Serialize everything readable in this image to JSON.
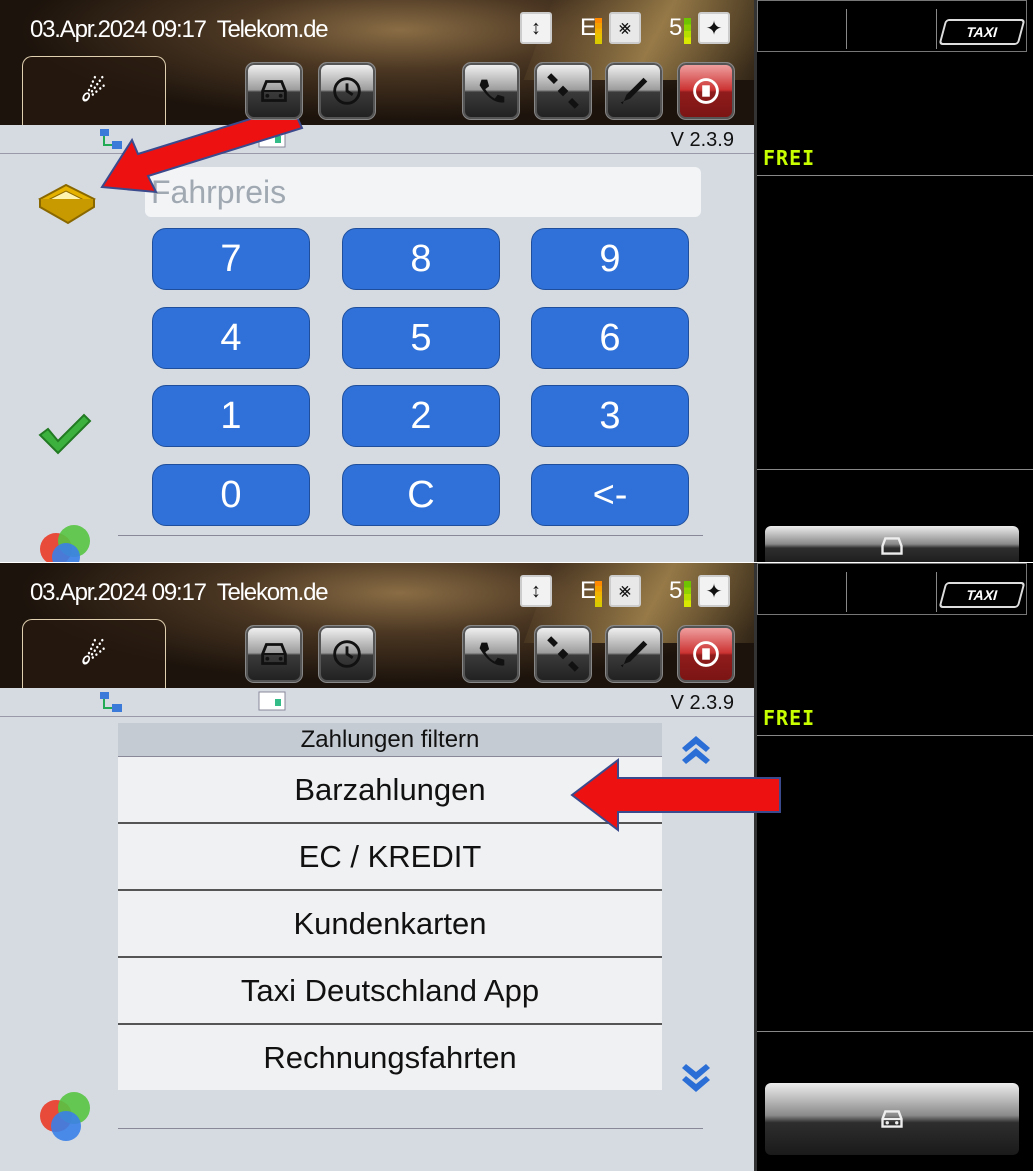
{
  "panels": [
    {
      "statusbar": {
        "datetime": "03.Apr.2024 09:17",
        "carrier": "Telekom.de",
        "signal_letter": "E",
        "satellites": "5"
      },
      "version": "V 2.3.9",
      "meter": {
        "taxi_tag": "TAXI",
        "status": "FREI"
      },
      "keypad": {
        "placeholder": "Fahrpreis",
        "keys": [
          "7",
          "8",
          "9",
          "4",
          "5",
          "6",
          "1",
          "2",
          "3",
          "0",
          "C",
          "<-"
        ]
      }
    },
    {
      "statusbar": {
        "datetime": "03.Apr.2024 09:17",
        "carrier": "Telekom.de",
        "signal_letter": "E",
        "satellites": "5"
      },
      "version": "V 2.3.9",
      "meter": {
        "taxi_tag": "TAXI",
        "status": "FREI"
      },
      "filter": {
        "title": "Zahlungen filtern",
        "items": [
          "Barzahlungen",
          "EC / KREDIT",
          "Kundenkarten",
          "Taxi Deutschland App",
          "Rechnungsfahrten"
        ]
      }
    }
  ],
  "icons": {
    "menu_tab": "menu-icon",
    "buttons": [
      "taxi-icon",
      "clock-icon",
      "phone-icon",
      "satellite-icon",
      "tools-icon",
      "logout-icon"
    ],
    "annotation_color": "#ee1111",
    "key_color": "#2f71d8"
  }
}
